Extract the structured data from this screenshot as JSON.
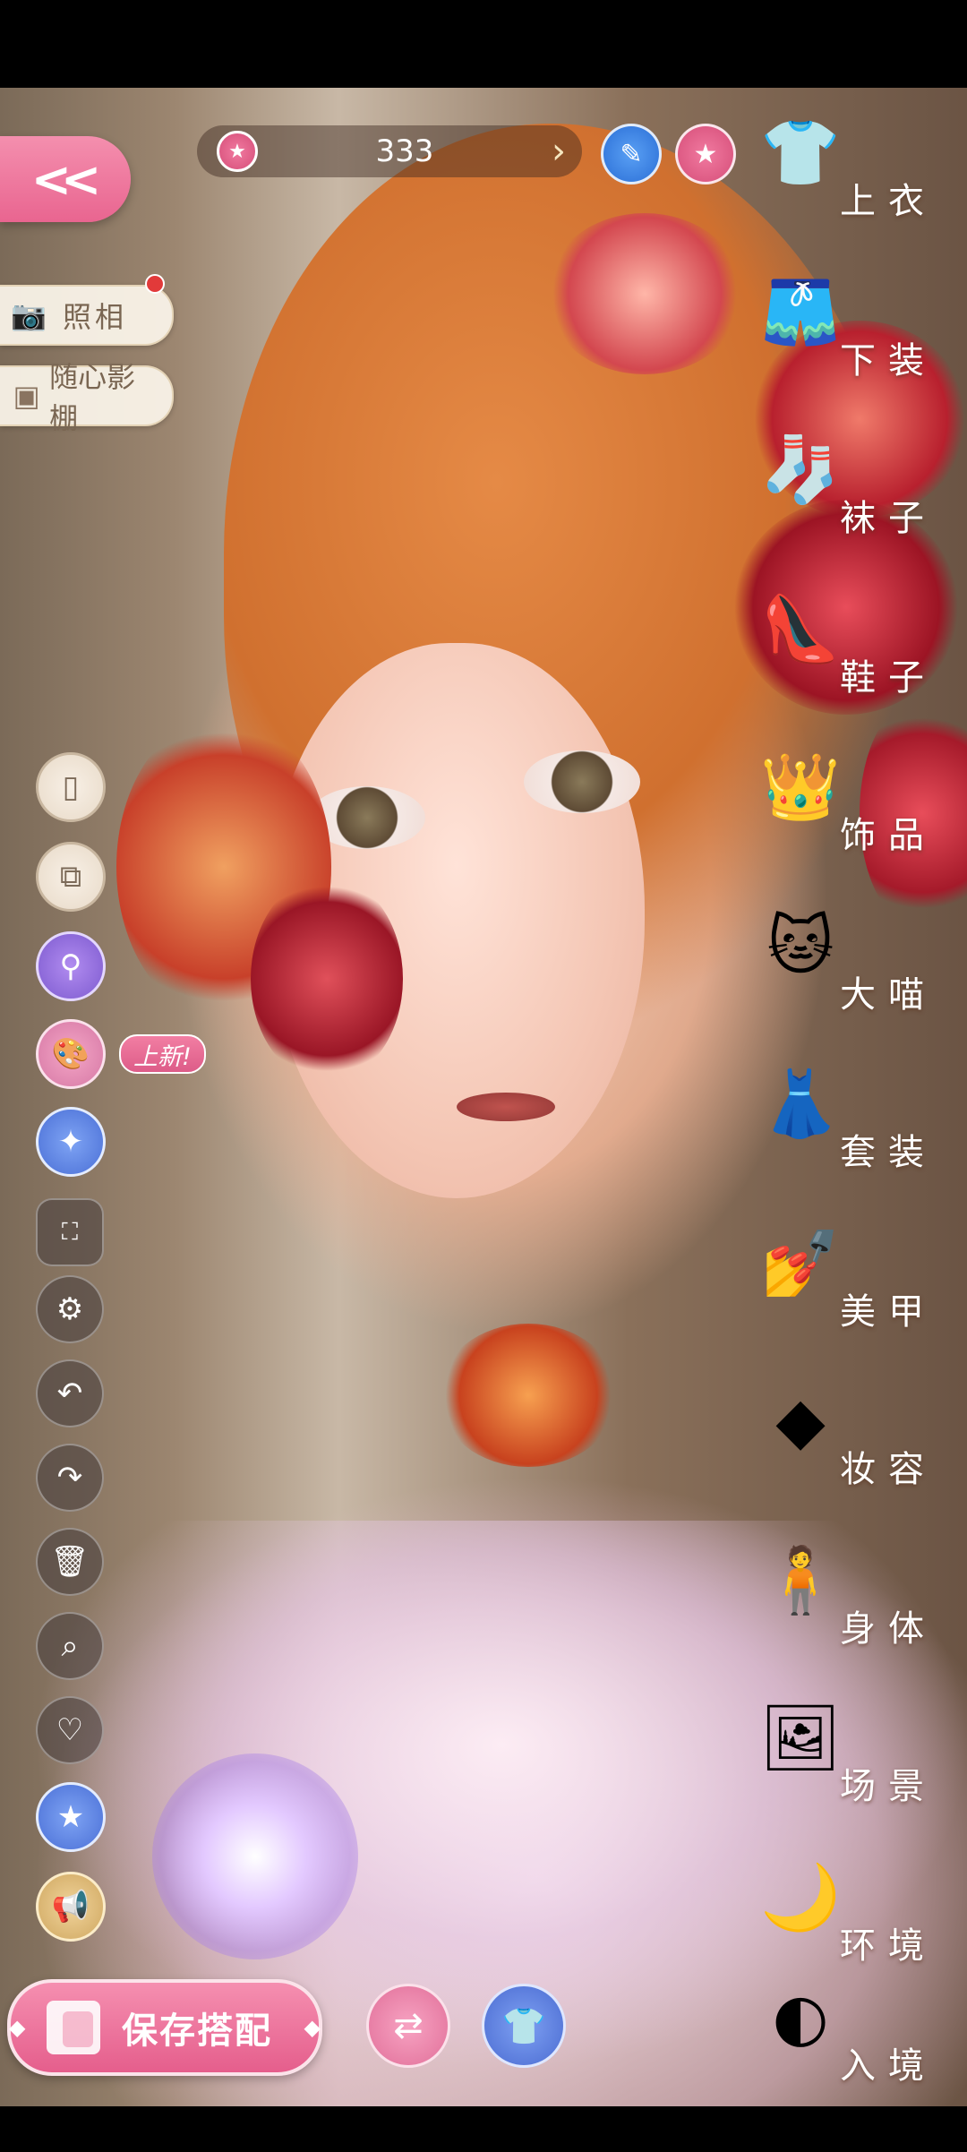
{
  "currency": {
    "amount": "333",
    "icon": "star-coin-icon"
  },
  "top_buttons": {
    "edit": "pencil-icon",
    "favorite": "star-icon"
  },
  "back": {
    "icon": "double-chevron-left-icon",
    "glyph": "<<"
  },
  "left_menu": {
    "photo_label": "照相",
    "studio_label": "随心影棚"
  },
  "tools": {
    "new_badge": "上新!"
  },
  "categories": [
    {
      "label": "上衣",
      "icon": "shirt-icon"
    },
    {
      "label": "下装",
      "icon": "shorts-icon"
    },
    {
      "label": "袜子",
      "icon": "socks-icon"
    },
    {
      "label": "鞋子",
      "icon": "shoe-icon"
    },
    {
      "label": "饰品",
      "icon": "tiara-icon"
    },
    {
      "label": "大喵",
      "icon": "cat-icon"
    },
    {
      "label": "套装",
      "icon": "outfit-icon"
    },
    {
      "label": "美甲",
      "icon": "nail-polish-icon"
    },
    {
      "label": "妆容",
      "icon": "makeup-icon"
    },
    {
      "label": "身体",
      "icon": "body-icon"
    },
    {
      "label": "场景",
      "icon": "scene-frame-icon"
    },
    {
      "label": "环境",
      "icon": "environment-icon"
    },
    {
      "label": "入境",
      "icon": "enter-scene-icon"
    }
  ],
  "save_button": {
    "label": "保存搭配"
  }
}
